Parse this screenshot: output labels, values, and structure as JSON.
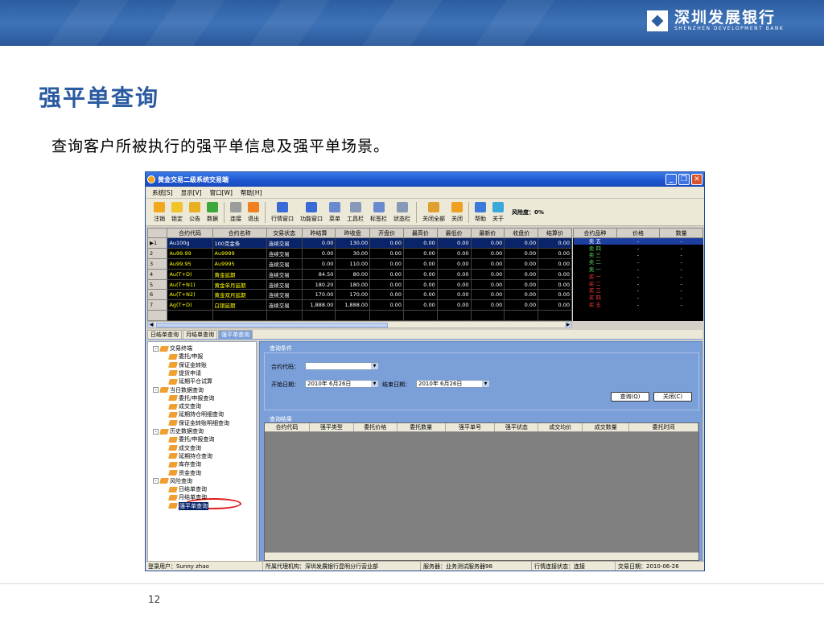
{
  "banner": {
    "logo_cn": "深圳发展银行",
    "logo_en": "SHENZHEN DEVELOPMENT BANK"
  },
  "slide": {
    "title": "强平单查询",
    "subtitle": "查询客户所被执行的强平单信息及强平单场景。",
    "page": "12"
  },
  "window": {
    "title": "黄金交易二级系统交易端"
  },
  "menu": [
    "系统[S]",
    "显示[V]",
    "窗口[W]",
    "帮助[H]"
  ],
  "toolbar": [
    {
      "label": "注销",
      "color": "#f2a81c"
    },
    {
      "label": "锁定",
      "color": "#f2c42c"
    },
    {
      "label": "公告",
      "color": "#e8b020"
    },
    {
      "label": "数据",
      "color": "#3aa83a"
    },
    {
      "label": "连接",
      "color": "#9c9c9c"
    },
    {
      "label": "退出",
      "color": "#f08020"
    },
    {
      "label": "行情窗口",
      "color": "#3a6ad8"
    },
    {
      "label": "功能窗口",
      "color": "#3a6ad8"
    },
    {
      "label": "菜单",
      "color": "#6a8ad0"
    },
    {
      "label": "工具栏",
      "color": "#8898b8"
    },
    {
      "label": "标签栏",
      "color": "#6a8ad0"
    },
    {
      "label": "状态栏",
      "color": "#8898b8"
    },
    {
      "label": "关闭全部",
      "color": "#e0a030"
    },
    {
      "label": "关闭",
      "color": "#f0a020"
    },
    {
      "label": "帮助",
      "color": "#3a7ad8"
    },
    {
      "label": "关于",
      "color": "#3aa8d8"
    }
  ],
  "risk_label": "风险度：0%",
  "quotes": {
    "headers": [
      "合约代码",
      "合约名称",
      "交易状态",
      "昨结算",
      "昨收盘",
      "开盘价",
      "最高价",
      "最低价",
      "最新价",
      "收盘价",
      "结算价"
    ],
    "rows": [
      {
        "idx": "1",
        "code": "Au100g",
        "name": "100克金条",
        "status": "连续交易",
        "vals": [
          "0.00",
          "130.00",
          "0.00",
          "0.00",
          "0.00",
          "0.00",
          "0.00",
          "0.00"
        ]
      },
      {
        "idx": "2",
        "code": "Au99.99",
        "name": "Au9999",
        "status": "连续交易",
        "vals": [
          "0.00",
          "30.00",
          "0.00",
          "0.00",
          "0.00",
          "0.00",
          "0.00",
          "0.00"
        ]
      },
      {
        "idx": "3",
        "code": "Au99.95",
        "name": "Au9995",
        "status": "连续交易",
        "vals": [
          "0.00",
          "110.00",
          "0.00",
          "0.00",
          "0.00",
          "0.00",
          "0.00",
          "0.00"
        ]
      },
      {
        "idx": "4",
        "code": "Au(T+D)",
        "name": "黄金延期",
        "status": "连续交易",
        "vals": [
          "84.50",
          "80.00",
          "0.00",
          "0.00",
          "0.00",
          "0.00",
          "0.00",
          "0.00"
        ]
      },
      {
        "idx": "5",
        "code": "Au(T+N1)",
        "name": "黄金单月延期",
        "status": "连续交易",
        "vals": [
          "180.20",
          "180.00",
          "0.00",
          "0.00",
          "0.00",
          "0.00",
          "0.00",
          "0.00"
        ]
      },
      {
        "idx": "6",
        "code": "Au(T+N2)",
        "name": "黄金双月延期",
        "status": "连续交易",
        "vals": [
          "170.00",
          "170.00",
          "0.00",
          "0.00",
          "0.00",
          "0.00",
          "0.00",
          "0.00"
        ]
      },
      {
        "idx": "7",
        "code": "Ag(T+D)",
        "name": "白银延期",
        "status": "连续交易",
        "vals": [
          "1,888.00",
          "1,888.00",
          "0.00",
          "0.00",
          "0.00",
          "0.00",
          "0.00",
          "0.00"
        ]
      }
    ]
  },
  "depth": {
    "headers": [
      "合约品种",
      "价格",
      "数量"
    ],
    "rows": [
      {
        "side": "sell",
        "label": "卖 五",
        "price": "-",
        "qty": "-"
      },
      {
        "side": "sell",
        "label": "卖 四",
        "price": "-",
        "qty": "-"
      },
      {
        "side": "sell",
        "label": "卖 三",
        "price": "-",
        "qty": "-"
      },
      {
        "side": "sell",
        "label": "卖 二",
        "price": "-",
        "qty": "-"
      },
      {
        "side": "sell",
        "label": "卖 一",
        "price": "-",
        "qty": "-"
      },
      {
        "side": "buy",
        "label": "买 一",
        "price": "-",
        "qty": "-"
      },
      {
        "side": "buy",
        "label": "买 二",
        "price": "-",
        "qty": "-"
      },
      {
        "side": "buy",
        "label": "买 三",
        "price": "-",
        "qty": "-"
      },
      {
        "side": "buy",
        "label": "买 四",
        "price": "-",
        "qty": "-"
      },
      {
        "side": "buy",
        "label": "买 五",
        "price": "-",
        "qty": "-"
      }
    ]
  },
  "tabs": [
    "日结单查询",
    "月结单查询",
    "强平单查询"
  ],
  "tree": [
    {
      "label": "交易终端",
      "level": 0,
      "toggle": "-"
    },
    {
      "label": "委托/申报",
      "level": 1
    },
    {
      "label": "保证金转账",
      "level": 1
    },
    {
      "label": "提货申请",
      "level": 1
    },
    {
      "label": "延期平仓试算",
      "level": 1
    },
    {
      "label": "当日数据查询",
      "level": 0,
      "toggle": "-"
    },
    {
      "label": "委托/申报查询",
      "level": 1
    },
    {
      "label": "成交查询",
      "level": 1
    },
    {
      "label": "延期持仓明细查询",
      "level": 1
    },
    {
      "label": "保证金转账明细查询",
      "level": 1
    },
    {
      "label": "历史数据查询",
      "level": 0,
      "toggle": "-"
    },
    {
      "label": "委托/申报查询",
      "level": 1
    },
    {
      "label": "成交查询",
      "level": 1
    },
    {
      "label": "延期持仓查询",
      "level": 1
    },
    {
      "label": "库存查询",
      "level": 1
    },
    {
      "label": "资金查询",
      "level": 1
    },
    {
      "label": "风险查询",
      "level": 0,
      "toggle": "-"
    },
    {
      "label": "日结单查询",
      "level": 1
    },
    {
      "label": "月结单查询",
      "level": 1
    },
    {
      "label": "强平单查询",
      "level": 1,
      "selected": true
    }
  ],
  "query": {
    "cond_title": "查询条件",
    "code_label": "合约代码：",
    "code_value": "",
    "start_label": "开始日期：",
    "start_value": "2010年 6月26日",
    "end_label": "结束日期：",
    "end_value": "2010年 6月26日",
    "query_btn": "查询(Q)",
    "close_btn": "关闭(C)",
    "result_title": "查询结果",
    "columns": [
      "合约代码",
      "强平类型",
      "委托价格",
      "委托数量",
      "强平单号",
      "强平状态",
      "成交均价",
      "成交数量",
      "委托时间"
    ]
  },
  "status": {
    "user": "登录用户：Sunny zhao",
    "branch": "所属代理机构：深圳发展银行昆明分行营业部",
    "server": "服务器：业务测试服务器98",
    "conn": "行情连接状态：连接",
    "date": "交易日期：2010-06-26"
  }
}
